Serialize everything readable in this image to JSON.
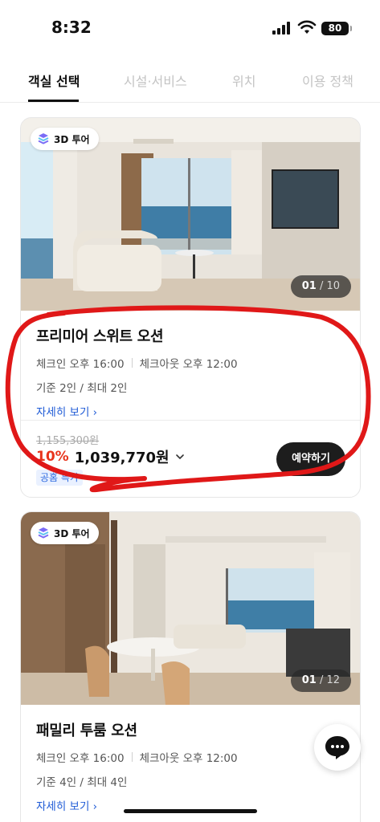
{
  "status_bar": {
    "time": "8:32",
    "battery": "80"
  },
  "tabs": [
    {
      "label": "객실 선택",
      "active": true
    },
    {
      "label": "시설·서비스",
      "active": false
    },
    {
      "label": "위치",
      "active": false
    },
    {
      "label": "이용 정책",
      "active": false
    }
  ],
  "rooms": [
    {
      "badge": "3D 투어",
      "photo_counter_current": "01",
      "photo_counter_total": "/ 10",
      "title": "프리미어 스위트 오션",
      "checkin": "체크인 오후 16:00",
      "checkout": "체크아웃 오후 12:00",
      "capacity": "기준 2인 / 최대 2인",
      "detail_link": "자세히 보기 ›",
      "original_price": "1,155,300원",
      "discount": "10%",
      "price": "1,039,770원",
      "promo": "공홈 특가",
      "book_label": "예약하기"
    },
    {
      "badge": "3D 투어",
      "photo_counter_current": "01",
      "photo_counter_total": "/ 12",
      "title": "패밀리 투룸 오션",
      "checkin": "체크인 오후 16:00",
      "checkout": "체크아웃 오후 12:00",
      "capacity": "기준 4인 / 최대 4인",
      "detail_link": "자세히 보기 ›"
    }
  ],
  "colors": {
    "discount": "#e8341c",
    "link": "#1f5bd6",
    "annotation": "#e01818"
  },
  "icons": [
    "cube-3d-icon",
    "chevron-down-icon",
    "chat-bubble-icon",
    "signal-icon",
    "wifi-icon",
    "battery-icon"
  ]
}
